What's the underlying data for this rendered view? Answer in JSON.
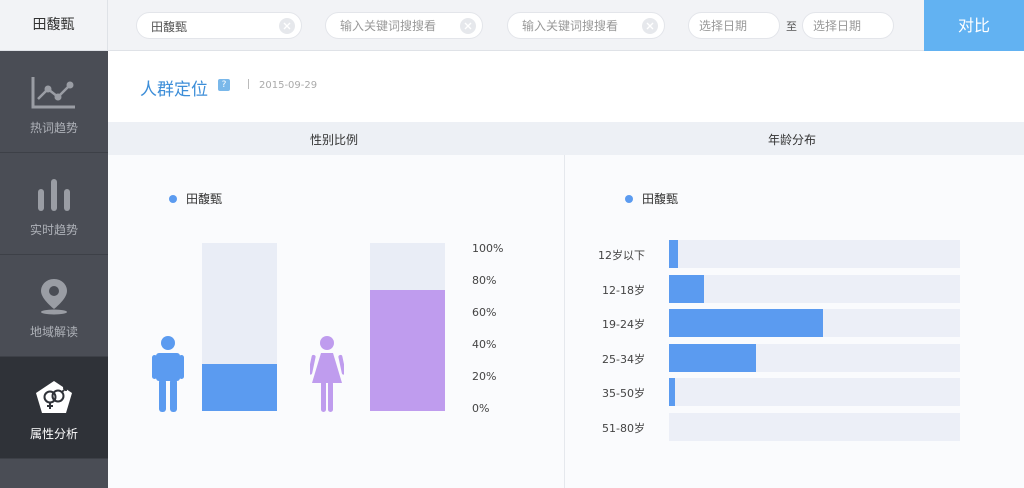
{
  "brand": "田馥甄",
  "search": {
    "field1_value": "田馥甄",
    "field2_placeholder": "输入关键词搜搜看",
    "field3_placeholder": "输入关键词搜搜看",
    "date_from_placeholder": "选择日期",
    "date_to_placeholder": "选择日期",
    "to_label": "至",
    "compare_label": "对比"
  },
  "sidebar": {
    "items": [
      {
        "label": "热词趋势",
        "icon": "line-chart-icon"
      },
      {
        "label": "实时趋势",
        "icon": "bar-chart-icon"
      },
      {
        "label": "地域解读",
        "icon": "map-pin-icon"
      },
      {
        "label": "属性分析",
        "icon": "gender-icon"
      }
    ]
  },
  "page": {
    "title": "人群定位",
    "help": "?",
    "date": "2015-09-29"
  },
  "gender": {
    "header": "性别比例",
    "legend": "田馥甄",
    "male_icon": "male-figure-icon",
    "female_icon": "female-figure-icon",
    "ticks": [
      "100%",
      "80%",
      "60%",
      "40%",
      "20%",
      "0%"
    ],
    "colors": {
      "male": "#5b9bf0",
      "female": "#bf9cee",
      "track": "#e9edf6"
    }
  },
  "chart_data": [
    {
      "type": "bar",
      "categories": [
        "male",
        "female"
      ],
      "values": [
        28,
        72
      ],
      "ylim": [
        0,
        100
      ],
      "ticks": [
        "100%",
        "80%",
        "60%",
        "40%",
        "20%",
        "0%"
      ]
    },
    {
      "type": "bar",
      "orientation": "horizontal",
      "categories": [
        "12岁以下",
        "12-18岁",
        "19-24岁",
        "25-34岁",
        "35-50岁",
        "51-80岁"
      ],
      "values": [
        3,
        12,
        53,
        30,
        2,
        0
      ],
      "xlim": [
        0,
        100
      ]
    }
  ],
  "age": {
    "header": "年龄分布",
    "legend": "田馥甄"
  }
}
